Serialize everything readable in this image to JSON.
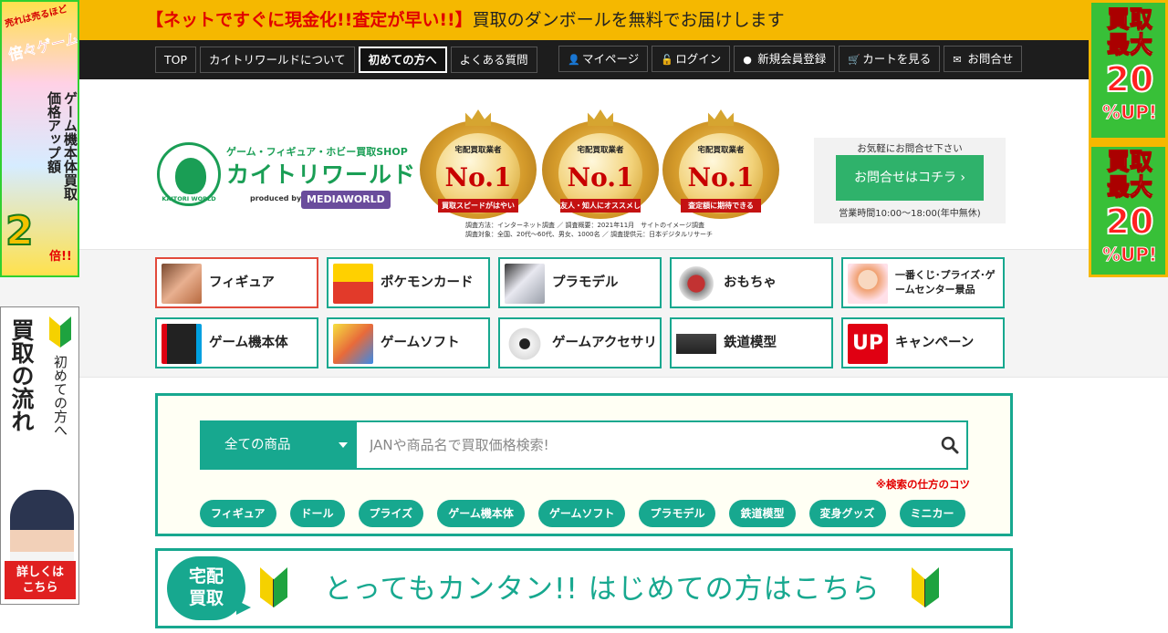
{
  "top_banner": {
    "highlight": "【ネットですぐに現金化!!査定が早い!!】",
    "text": "買取のダンボールを無料でお届けします"
  },
  "nav": {
    "left": [
      "TOP",
      "カイトリワールドについて",
      "初めての方へ",
      "よくある質問"
    ],
    "right": [
      {
        "icon": "user-icon",
        "glyph": "👤",
        "label": "マイページ"
      },
      {
        "icon": "unlock-icon",
        "glyph": "🔓",
        "label": "ログイン"
      },
      {
        "icon": "user-circle-icon",
        "glyph": "●",
        "label": "新規会員登録"
      },
      {
        "icon": "cart-icon",
        "glyph": "🛒",
        "label": "カートを見る"
      },
      {
        "icon": "envelope-icon",
        "glyph": "✉",
        "label": "お問合せ"
      }
    ]
  },
  "logo": {
    "subtitle": "ゲーム・フィギュア・ホビー買取SHOP",
    "name": "カイトリワールド",
    "produced_by": "produced by",
    "company": "MEDIAWORLD",
    "ring_text": "KAITORI WORLD"
  },
  "awards": [
    {
      "line1": "宅配買取業者",
      "line2": "ゲーム\nホビー部門",
      "rank": "No.1",
      "ribbon": "買取スピードがはやい"
    },
    {
      "line1": "宅配買取業者",
      "line2": "ゲーム\nホビー部門",
      "rank": "No.1",
      "ribbon": "友人・知人にオススメしたい"
    },
    {
      "line1": "宅配買取業者",
      "line2": "ゲーム\nホビー部門",
      "rank": "No.1",
      "ribbon": "査定額に期待できる"
    }
  ],
  "awards_note": {
    "line1": "調査方法：インターネット調査 ／ 調査概要：2021年11月　サイトのイメージ調査",
    "line2": "調査対象：全国、20代〜60代、男女、1000名 ／ 調査提供元：日本デジタルリサーチ"
  },
  "contact": {
    "label": "お気軽にお問合せ下さい",
    "button": "お問合せはコチラ ›",
    "hours": "営業時間10:00〜18:00(年中無休)"
  },
  "categories": [
    {
      "label": "フィギュア",
      "color": "#c98a6a"
    },
    {
      "label": "ポケモンカード",
      "color": "#e23a2a"
    },
    {
      "label": "プラモデル",
      "color": "#9aa0aa"
    },
    {
      "label": "おもちゃ",
      "color": "#c23232"
    },
    {
      "label": "一番くじ･プライズ･ゲームセンター景品",
      "color": "#f0a070"
    },
    {
      "label": "ゲーム機本体",
      "color": "#333333"
    },
    {
      "label": "ゲームソフト",
      "color": "#e86a3a"
    },
    {
      "label": "ゲームアクセサリ",
      "color": "#dcdcdc"
    },
    {
      "label": "鉄道模型",
      "color": "#444444"
    },
    {
      "label": "キャンペーン",
      "color": "#e00012"
    }
  ],
  "campaign_badge": "UP",
  "search": {
    "select_value": "全ての商品",
    "placeholder": "JANや商品名で買取価格検索!",
    "tips": "※検索の仕方のコツ",
    "tags": [
      "フィギュア",
      "ドール",
      "プライズ",
      "ゲーム機本体",
      "ゲームソフト",
      "プラモデル",
      "鉄道模型",
      "変身グッズ",
      "ミニカー"
    ]
  },
  "beginner_banner": {
    "bubble": "宅配\n買取",
    "text": "とってもカンタン!! はじめての方はこちら"
  },
  "ad_left_top": {
    "t1": "売れは売るほど",
    "t2": "倍々ゲーム祭り!",
    "vertical": "ゲーム機本体買取価格アップ額",
    "big": "2",
    "suffix": "倍!!"
  },
  "ad_left_bottom": {
    "vertical_big": "買取の流れ",
    "vertical_small": "初めての方へ",
    "more": "詳しくは\nこちら"
  },
  "ad_right": {
    "kaitori": "買取",
    "saidai": "最大",
    "num": "20",
    "up": "%UP!"
  }
}
